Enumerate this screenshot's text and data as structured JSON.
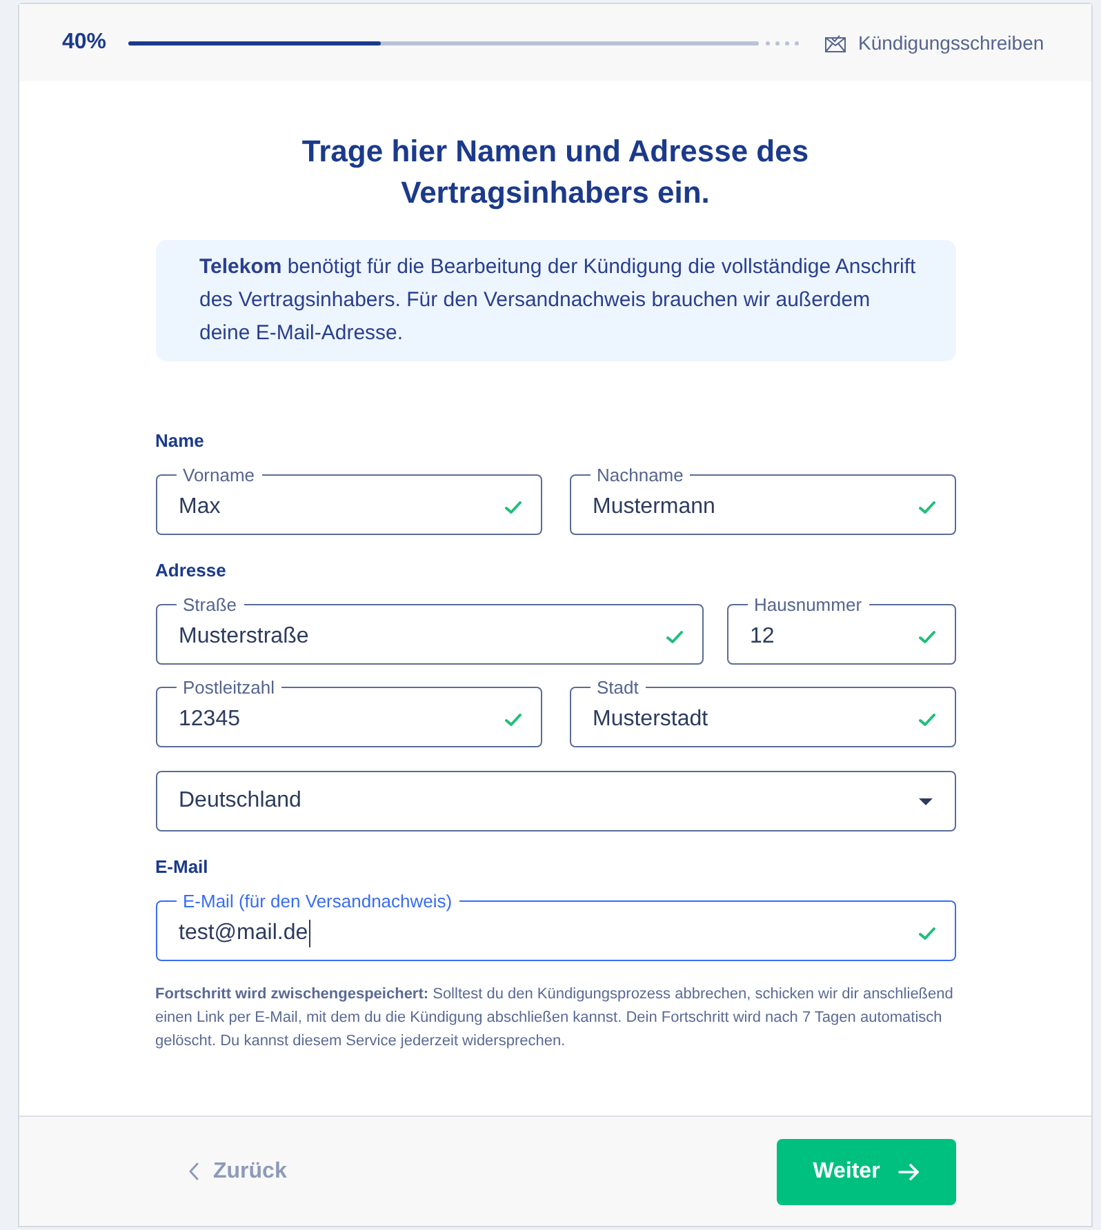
{
  "progress": {
    "percent": "40%",
    "level": 0.4,
    "next_step": "Kündigungsschreiben"
  },
  "title": "Trage hier Namen und Adresse des Vertragsinhabers ein.",
  "info": "**Telekom** benötigt für die Bearbeitung der Kündigung die vollständige Anschrift des Vertragsinhabers. Für den Versandnachweis brauchen wir außerdem deine E-Mail-Adresse.",
  "sections": [
    {
      "heading": "Name",
      "rows": [
        {
          "kind": "pair",
          "fields": [
            {
              "kind": "text",
              "label": "Vorname",
              "value": "Max",
              "valid": true,
              "focused": false
            },
            {
              "kind": "text",
              "label": "Nachname",
              "value": "Mustermann",
              "valid": true,
              "focused": false
            }
          ]
        }
      ]
    },
    {
      "heading": "Adresse",
      "rows": [
        {
          "kind": "wide_narrow",
          "fields": [
            {
              "kind": "text",
              "label": "Straße",
              "value": "Musterstraße",
              "valid": true,
              "focused": false
            },
            {
              "kind": "text",
              "label": "Hausnummer",
              "value": "12",
              "valid": true,
              "focused": false
            }
          ]
        },
        {
          "kind": "pair",
          "fields": [
            {
              "kind": "text",
              "label": "Postleitzahl",
              "value": "12345",
              "valid": true,
              "focused": false
            },
            {
              "kind": "text",
              "label": "Stadt",
              "value": "Musterstadt",
              "valid": true,
              "focused": false
            }
          ]
        },
        {
          "kind": "single",
          "fields": [
            {
              "kind": "select",
              "value": "Deutschland"
            }
          ]
        }
      ]
    },
    {
      "heading": "E-Mail",
      "rows": [
        {
          "kind": "single",
          "fields": [
            {
              "kind": "text",
              "label": "E-Mail (für den Versandnachweis)",
              "value": "test@mail.de",
              "valid": true,
              "focused": true
            }
          ]
        }
      ]
    }
  ],
  "note": "**Fortschritt wird zwischengespeichert:** Solltest du den Kündigungsprozess abbrechen, schicken wir dir anschließend einen Link per E-Mail, mit dem du die Kündigung abschließen kannst. Dein Fortschritt wird nach 7 Tagen automatisch gelöscht. Du kannst diesem Service jederzeit widersprechen.",
  "footer": {
    "back": "Zurück",
    "next": "Weiter"
  }
}
